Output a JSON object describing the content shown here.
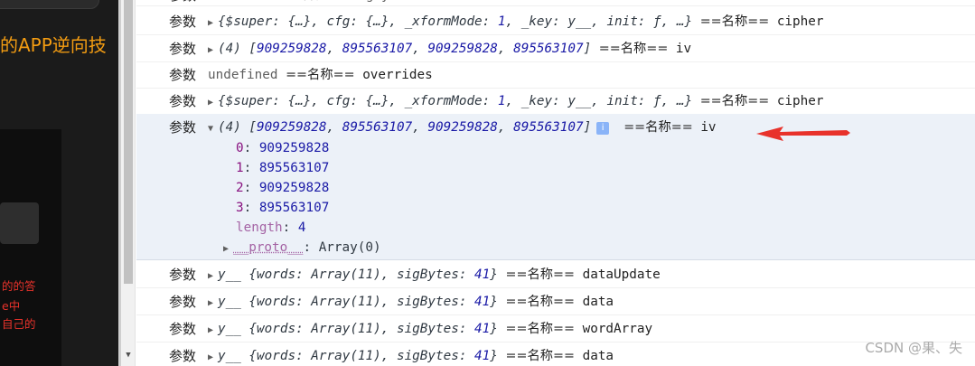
{
  "page": {
    "title_fragment": "的APP逆向技",
    "red_lines": [
      "的的答",
      "e中",
      "自己的"
    ]
  },
  "console": {
    "label": "参数",
    "name_sep": "==名称==",
    "rows_top": [
      {
        "text": "undefined ==名称== sigBytes"
      },
      {
        "text": "▶{$super: {…}, cfg: {…}, _xformMode: 1, _key: y__, init: ƒ, …} ==名称== cipher"
      },
      {
        "text": "▶(4) [909259828, 895563107, 909259828, 895563107] ==名称== iv"
      },
      {
        "text": "undefined ==名称== overrides"
      },
      {
        "text": "▶{$super: {…}, cfg: {…}, _xformMode: 1, _key: y__, init: ƒ, …} ==名称== cipher"
      }
    ],
    "expanded": {
      "summary": "(4) [909259828, 895563107, 909259828, 895563107]",
      "info_icon": "i",
      "name": "iv",
      "items": [
        {
          "key": "0",
          "value": "909259828"
        },
        {
          "key": "1",
          "value": "895563107"
        },
        {
          "key": "2",
          "value": "909259828"
        },
        {
          "key": "3",
          "value": "895563107"
        }
      ],
      "length_key": "length",
      "length_value": "4",
      "proto_key": "__proto__",
      "proto_value": "Array(0)"
    },
    "rows_bottom": [
      {
        "obj": "y__ {words: Array(11), sigBytes: 41}",
        "name": "dataUpdate"
      },
      {
        "obj": "y__ {words: Array(11), sigBytes: 41}",
        "name": "data"
      },
      {
        "obj": "y__ {words: Array(11), sigBytes: 41}",
        "name": "wordArray"
      },
      {
        "obj": "y__ {words: Array(11), sigBytes: 41}",
        "name": "data"
      }
    ]
  },
  "icons": {
    "expand": "triangle-right-icon",
    "collapse": "triangle-down-icon",
    "info": "info-icon",
    "arrow": "red-arrow-annotation"
  },
  "colors": {
    "number": "#1a1aa6",
    "key": "#881280",
    "expanded_bg": "#ecf1f8",
    "arrow": "#e8322b"
  },
  "watermark": "CSDN @果、失"
}
